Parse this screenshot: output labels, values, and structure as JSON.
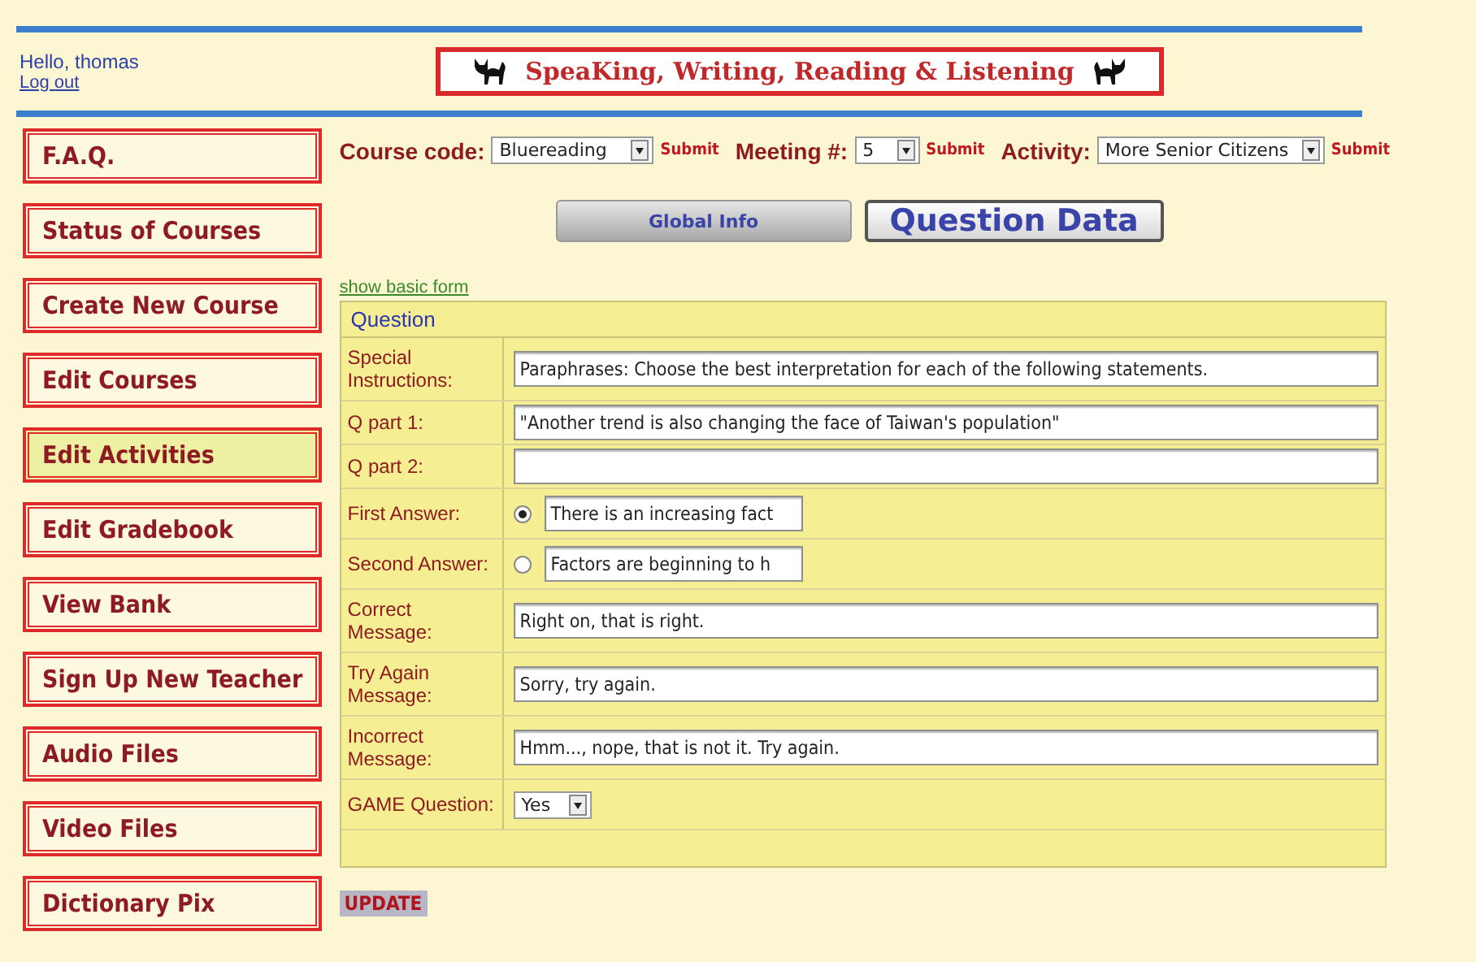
{
  "header": {
    "greeting": "Hello, thomas",
    "logout": "Log out",
    "banner_title": "SpeaKing, Writing, Reading & Listening"
  },
  "sidebar": {
    "items": [
      {
        "label": "F.A.Q.",
        "selected": false
      },
      {
        "label": "Status of Courses",
        "selected": false
      },
      {
        "label": "Create New Course",
        "selected": false
      },
      {
        "label": "Edit Courses",
        "selected": false
      },
      {
        "label": "Edit Activities",
        "selected": true
      },
      {
        "label": "Edit Gradebook",
        "selected": false
      },
      {
        "label": "View Bank",
        "selected": false
      },
      {
        "label": "Sign Up New Teacher",
        "selected": false
      },
      {
        "label": "Audio Files",
        "selected": false
      },
      {
        "label": "Video Files",
        "selected": false
      },
      {
        "label": "Dictionary Pix",
        "selected": false
      }
    ]
  },
  "filters": [
    {
      "label": "Course code:",
      "value": "Bluereading",
      "button": "Submit"
    },
    {
      "label": "Meeting #:",
      "value": "5",
      "button": "Submit"
    },
    {
      "label": "Activity:",
      "value": "More Senior Citizens",
      "button": "Submit"
    }
  ],
  "tabs": [
    {
      "label": "Global Info",
      "selected": false
    },
    {
      "label": "Question Data",
      "selected": true
    }
  ],
  "basic_form_link": "show basic form",
  "form": {
    "title": "Question",
    "rows": [
      {
        "kind": "text",
        "label": "Special Instructions:",
        "value": "Paraphrases: Choose the best interpretation for each of the following statements."
      },
      {
        "kind": "text",
        "label": "Q part 1:",
        "value": "\"Another trend is also changing the face of Taiwan's population\""
      },
      {
        "kind": "text",
        "label": "Q part 2:"
      },
      {
        "kind": "radio",
        "label": "First Answer:",
        "selected": true,
        "value": "There is an increasing fact"
      },
      {
        "kind": "radio",
        "label": "Second Answer:",
        "selected": false,
        "value": "Factors are beginning to h"
      },
      {
        "kind": "text",
        "label": "Correct Message:",
        "value": "Right on, that is right."
      },
      {
        "kind": "text",
        "label": "Try Again Message:",
        "value": "Sorry, try again."
      },
      {
        "kind": "text",
        "label": "Incorrect Message:",
        "value": "Hmm..., nope, that is not it.  Try again."
      },
      {
        "kind": "select",
        "label": "GAME Question:",
        "value": "Yes"
      }
    ]
  },
  "update_button": "UPDATE"
}
